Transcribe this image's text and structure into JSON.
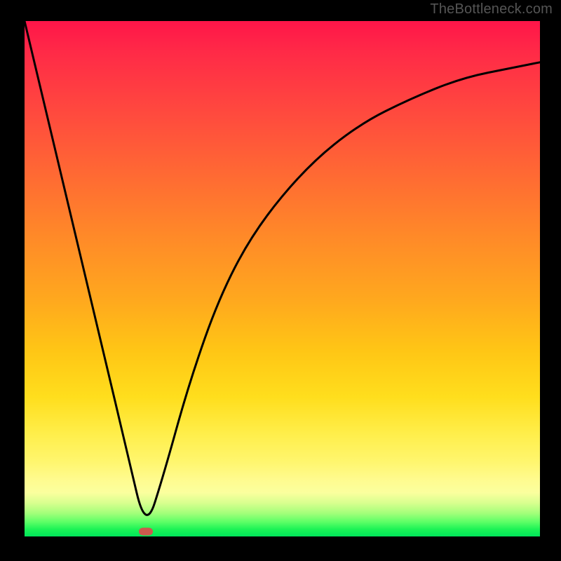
{
  "attribution": "TheBottleneck.com",
  "chart_data": {
    "type": "line",
    "title": "",
    "xlabel": "",
    "ylabel": "",
    "x_range": [
      0,
      100
    ],
    "y_range": [
      0,
      100
    ],
    "background_gradient": {
      "direction": "vertical",
      "stops": [
        {
          "pct": 0,
          "meaning": "bottleneck-high",
          "color": "#ff1549"
        },
        {
          "pct": 50,
          "meaning": "bottleneck-mid",
          "color": "#ffb018"
        },
        {
          "pct": 90,
          "meaning": "bottleneck-low",
          "color": "#fff97f"
        },
        {
          "pct": 100,
          "meaning": "bottleneck-none",
          "color": "#00e65a"
        }
      ]
    },
    "series": [
      {
        "name": "bottleneck-curve",
        "color": "#000000",
        "x": [
          0,
          5,
          10,
          15,
          20,
          23.5,
          27,
          32,
          38,
          45,
          55,
          65,
          75,
          85,
          95,
          100
        ],
        "y": [
          100,
          79,
          58,
          37,
          16,
          1,
          12,
          30,
          47,
          60,
          72,
          80,
          85,
          89,
          91,
          92
        ]
      }
    ],
    "marker": {
      "name": "current-config",
      "x": 23.5,
      "y": 1,
      "color": "#cc5a4d"
    }
  }
}
